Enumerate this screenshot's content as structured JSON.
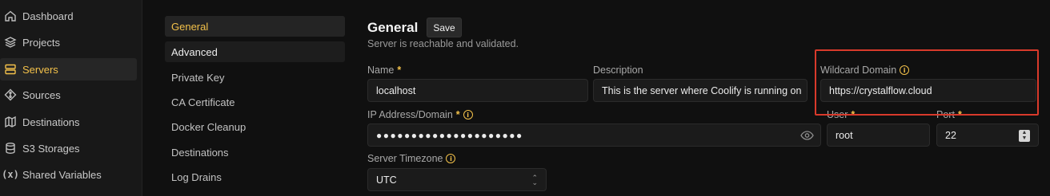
{
  "sidebar": {
    "items": [
      {
        "label": "Dashboard",
        "icon": "home-icon"
      },
      {
        "label": "Projects",
        "icon": "layers-icon"
      },
      {
        "label": "Servers",
        "icon": "server-icon",
        "active": true
      },
      {
        "label": "Sources",
        "icon": "git-icon"
      },
      {
        "label": "Destinations",
        "icon": "network-icon"
      },
      {
        "label": "S3 Storages",
        "icon": "database-icon"
      },
      {
        "label": "Shared Variables",
        "icon": "variable-icon"
      }
    ]
  },
  "subnav": {
    "items": [
      {
        "label": "General",
        "active": true
      },
      {
        "label": "Advanced"
      },
      {
        "label": "Private Key"
      },
      {
        "label": "CA Certificate"
      },
      {
        "label": "Docker Cleanup"
      },
      {
        "label": "Destinations"
      },
      {
        "label": "Log Drains"
      }
    ]
  },
  "header": {
    "title": "General",
    "save_label": "Save",
    "subtitle": "Server is reachable and validated."
  },
  "form": {
    "name": {
      "label": "Name",
      "required": "*",
      "value": "localhost"
    },
    "description": {
      "label": "Description",
      "value": "This is the server where Coolify is running on"
    },
    "wildcard": {
      "label": "Wildcard Domain",
      "value": "https://crystalflow.cloud"
    },
    "ip": {
      "label": "IP Address/Domain",
      "required": "*",
      "value": "●●●●●●●●●●●●●●●●●●●●●"
    },
    "user": {
      "label": "User",
      "required": "*",
      "value": "root"
    },
    "port": {
      "label": "Port",
      "required": "*",
      "value": "22"
    },
    "timezone": {
      "label": "Server Timezone",
      "value": "UTC"
    }
  },
  "colors": {
    "accent": "#f3c14a",
    "highlight": "#d93a2b",
    "background": "#101010"
  }
}
